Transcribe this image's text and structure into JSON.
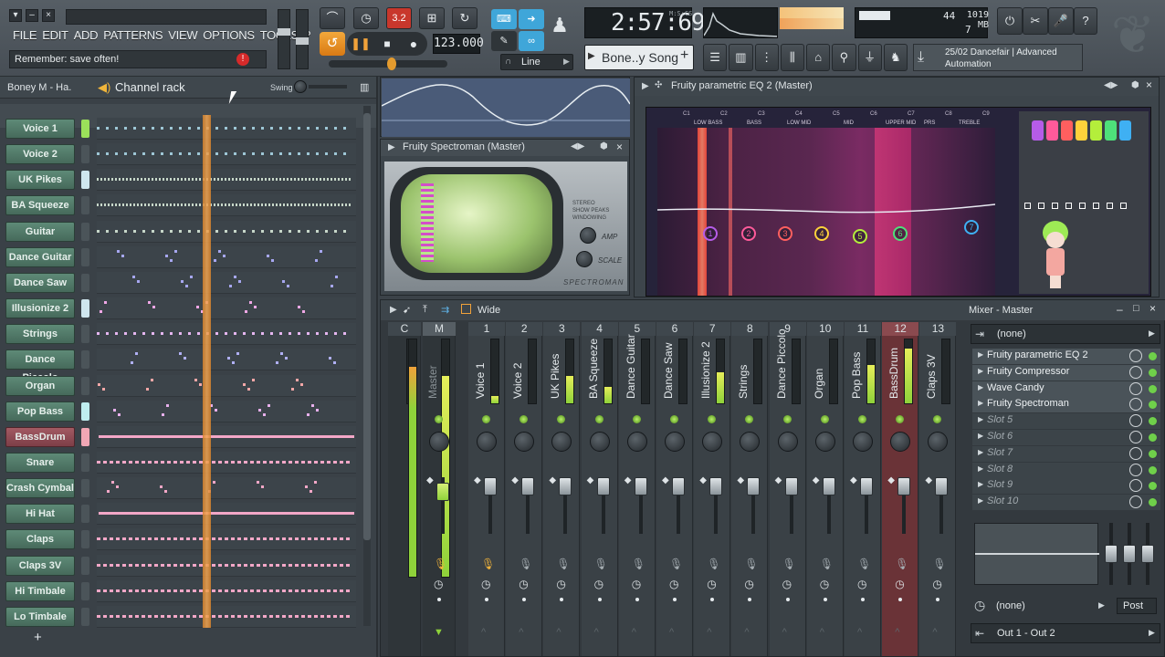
{
  "menu": [
    "FILE",
    "EDIT",
    "ADD",
    "PATTERNS",
    "VIEW",
    "OPTIONS",
    "TOOLS",
    "?"
  ],
  "hint": "Remember: save often!",
  "transport": {
    "tempo": "123.000",
    "pattern_mode": "Line"
  },
  "time": {
    "display": "2:57:69",
    "unit": "M:S:CS"
  },
  "cpu": {
    "poly": "44",
    "memory": "1019 MB",
    "value": "7"
  },
  "song_name": "Bone..y Song",
  "news": "25/02 Dancefair | Advanced Automation",
  "rack": {
    "project": "Boney M - Ha.",
    "title": "Channel rack",
    "swing_label": "Swing",
    "channels": [
      "Voice 1",
      "Voice 2",
      "UK Pikes",
      "BA Squeeze",
      "Guitar",
      "Dance Guitar",
      "Dance Saw",
      "Illusionize 2",
      "Strings",
      "Dance Piccolo",
      "Organ",
      "Pop Bass",
      "BassDrum",
      "Snare",
      "Crash Cymbal",
      "Hi Hat",
      "Claps",
      "Claps 3V",
      "Hi Timbale",
      "Lo Timbale"
    ],
    "selected": "BassDrum",
    "add_label": "+"
  },
  "spectroman": {
    "title": "Fruity Spectroman (Master)",
    "opts": [
      "STEREO",
      "SHOW PEAKS",
      "WINDOWING"
    ],
    "amp": "AMP",
    "scale": "SCALE",
    "brand": "SPECTROMAN"
  },
  "eq": {
    "title": "Fruity parametric EQ 2 (Master)",
    "notes": [
      "C1",
      "C2",
      "C3",
      "C4",
      "C5",
      "C6",
      "C7",
      "C8",
      "C9"
    ],
    "bands": [
      "LOW BASS",
      "BASS",
      "LOW MID",
      "MID",
      "UPPER MID",
      "PRS",
      "TREBLE"
    ],
    "points": [
      "1",
      "2",
      "3",
      "4",
      "5",
      "6",
      "7"
    ]
  },
  "mixer": {
    "view": "Wide",
    "title": "Mixer - Master",
    "insert_label": "(none)",
    "strips": [
      {
        "num": "C",
        "name": ""
      },
      {
        "num": "M",
        "name": "Master"
      },
      {
        "num": "1",
        "name": "Voice 1"
      },
      {
        "num": "2",
        "name": "Voice 2"
      },
      {
        "num": "3",
        "name": "UK Pikes"
      },
      {
        "num": "4",
        "name": "BA Squeeze"
      },
      {
        "num": "5",
        "name": "Dance Guitar"
      },
      {
        "num": "6",
        "name": "Dance Saw"
      },
      {
        "num": "7",
        "name": "Illusionize 2"
      },
      {
        "num": "8",
        "name": "Strings"
      },
      {
        "num": "9",
        "name": "Dance Piccolo"
      },
      {
        "num": "10",
        "name": "Organ"
      },
      {
        "num": "11",
        "name": "Pop Bass"
      },
      {
        "num": "12",
        "name": "BassDrum"
      },
      {
        "num": "13",
        "name": "Claps 3V"
      }
    ],
    "slots": [
      "Fruity parametric EQ 2",
      "Fruity Compressor",
      "Wave Candy",
      "Fruity Spectroman",
      "Slot 5",
      "Slot 6",
      "Slot 7",
      "Slot 8",
      "Slot 9",
      "Slot 10"
    ],
    "active_slots": 4,
    "send_label": "(none)",
    "post_label": "Post",
    "output": "Out 1 - Out 2"
  },
  "colors": {
    "accent": "#f39c2b",
    "eq_bg": "#3a1c3a",
    "strip_sel": "#7a3a3e",
    "led_green": "#8ed23a"
  }
}
